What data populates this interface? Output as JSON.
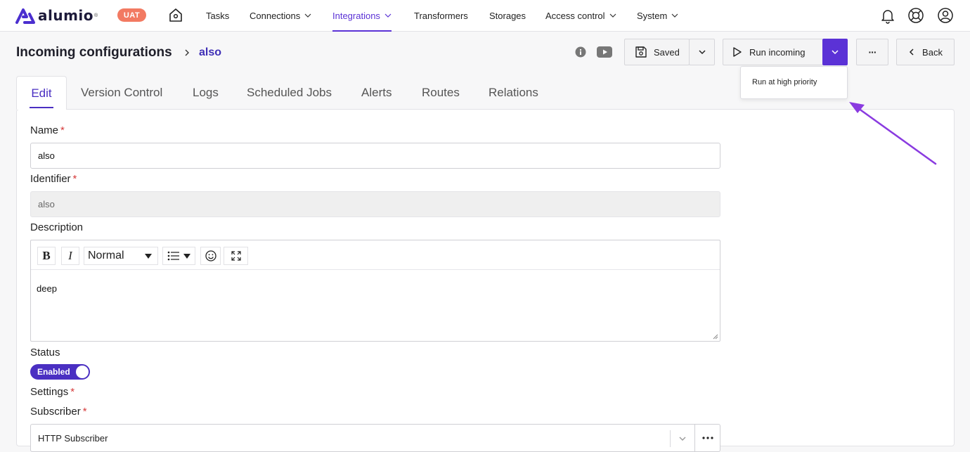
{
  "brand": {
    "name": "alumio",
    "reg": "®",
    "env_badge": "UAT"
  },
  "nav": {
    "items": [
      {
        "label": "Tasks",
        "has_menu": false,
        "active": false
      },
      {
        "label": "Connections",
        "has_menu": true,
        "active": false
      },
      {
        "label": "Integrations",
        "has_menu": true,
        "active": true
      },
      {
        "label": "Transformers",
        "has_menu": false,
        "active": false
      },
      {
        "label": "Storages",
        "has_menu": false,
        "active": false
      },
      {
        "label": "Access control",
        "has_menu": true,
        "active": false
      },
      {
        "label": "System",
        "has_menu": true,
        "active": false
      }
    ],
    "icons": [
      "home-icon",
      "bell-icon",
      "support-icon",
      "user-icon"
    ]
  },
  "header": {
    "title": "Incoming configurations",
    "current": "also",
    "icons": [
      "info-icon",
      "youtube-icon"
    ]
  },
  "actions": {
    "saved_label": "Saved",
    "run_label": "Run incoming",
    "back_label": "Back",
    "more_label": "···",
    "dropdown_item": "Run at high priority"
  },
  "tabs": [
    "Edit",
    "Version Control",
    "Logs",
    "Scheduled Jobs",
    "Alerts",
    "Routes",
    "Relations"
  ],
  "form": {
    "name_label": "Name",
    "name_value": "also",
    "identifier_label": "Identifier",
    "identifier_value": "also",
    "description_label": "Description",
    "editor_format": "Normal",
    "editor_bold": "B",
    "editor_italic": "I",
    "description_value": "deep",
    "status_label": "Status",
    "status_value": "Enabled",
    "settings_label": "Settings",
    "subscriber_label": "Subscriber",
    "subscriber_value": "HTTP Subscriber",
    "required_mark": "*"
  },
  "colors": {
    "accent": "#5b32d6",
    "badge": "#f27a62",
    "required": "#d63b3b",
    "annotation": "#8a3be0"
  }
}
